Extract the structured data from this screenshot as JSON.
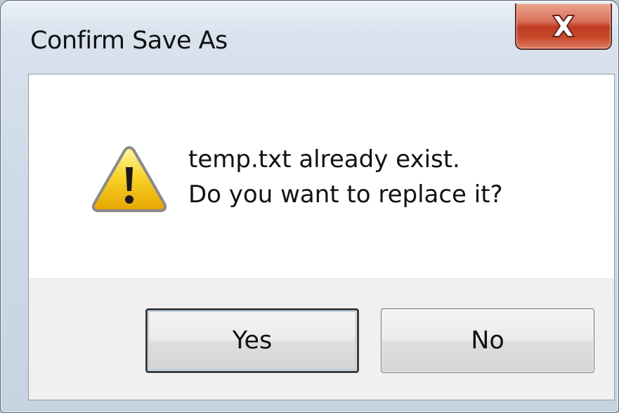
{
  "window": {
    "title": "Confirm Save As",
    "close_icon": "close-icon"
  },
  "dialog": {
    "icon": "warning-icon",
    "message_line1": "temp.txt already exist.",
    "message_line2": "Do you want to replace it?"
  },
  "buttons": {
    "yes_label": "Yes",
    "no_label": "No"
  },
  "colors": {
    "close_button_red": "#c13c22",
    "warning_yellow": "#f5c400",
    "frame_blue": "#cfdbe8"
  }
}
